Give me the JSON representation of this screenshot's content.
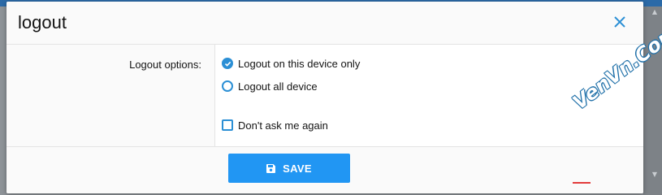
{
  "dialog": {
    "title": "logout",
    "close_icon": "close-icon"
  },
  "form": {
    "label": "Logout options:",
    "options": [
      {
        "label": "Logout on this device only",
        "selected": true
      },
      {
        "label": "Logout all device",
        "selected": false
      }
    ],
    "dont_ask": {
      "label": "Don't ask me again",
      "checked": false
    }
  },
  "footer": {
    "save_label": "SAVE",
    "save_icon": "save-icon"
  },
  "watermark": {
    "text": "VenVn.Com"
  },
  "colors": {
    "accent": "#2196f3",
    "radio": "#2b8fd5",
    "close": "#2b8fd5"
  }
}
